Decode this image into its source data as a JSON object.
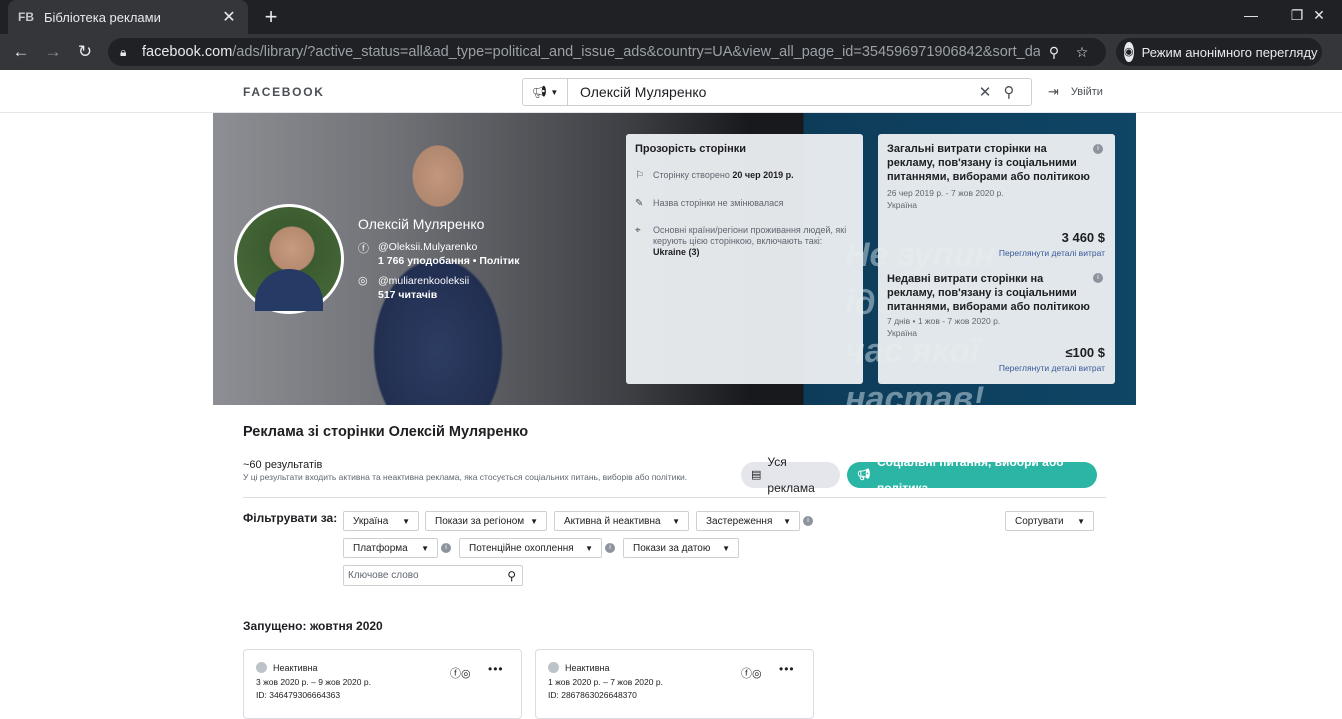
{
  "browser": {
    "tab_favicon": "FB",
    "tab_title": "Бібліотека реклами",
    "tab_close": "✕",
    "new_tab": "+",
    "url_domain": "facebook.com",
    "url_rest": "/ads/library/?active_status=all&ad_type=political_and_issue_ads&country=UA&view_all_page_id=354596971906842&sort_data[di...",
    "incognito_label": "Режим анонімного перегляду"
  },
  "fb_header": {
    "logo": "FACEBOOK",
    "search_query": "Олексій Муляренко",
    "logout_label": "Увійти"
  },
  "banner": {
    "slogan_lines": [
      "Не зупин",
      "ід",
      "час якої",
      "настав!"
    ],
    "page_name": "Олексій Муляренко",
    "facebook_handle": "@Oleksii.Mulyarenko",
    "facebook_stats": "1 766 уподобання • Політик",
    "instagram_handle": "@muliarenkooleksii",
    "instagram_stats": "517 читачів",
    "transparency": {
      "title": "Прозорість сторінки",
      "created_prefix": "Сторінку створено",
      "created_date": "20 чер 2019 р.",
      "name_unchanged": "Назва сторінки не змінювалася",
      "countries_text": "Основні країни/регіони проживання людей, які керують цією сторінкою, включають такі:",
      "countries_value": "Ukraine (3)"
    },
    "spend_total": {
      "title": "Загальні витрати сторінки на рекламу, пов'язану із соціальними питаннями, виборами або політикою",
      "period": "26 чер 2019 р. - 7 жов 2020 р.",
      "country": "Україна",
      "amount": "3 460 $",
      "link": "Переглянути деталі витрат"
    },
    "spend_recent": {
      "title": "Недавні витрати сторінки на рекламу, пов'язану із соціальними питаннями, виборами або політикою",
      "period": "7 днів • 1 жов - 7 жов 2020 р.",
      "country": "Україна",
      "amount": "≤100 $",
      "link": "Переглянути деталі витрат"
    }
  },
  "main": {
    "heading": "Реклама зі сторінки Олексій Муляренко",
    "results_count": "~60 результатів",
    "results_note": "У ці результати входить активна та неактивна реклама, яка стосується соціальних питань, виборів або політики.",
    "pill_all": "Уся реклама",
    "pill_social": "Соціальні питання, вибори або політика",
    "filter_label": "Фільтрувати за:",
    "filters": {
      "country": "Україна",
      "region": "Покази за регіоном",
      "status": "Активна й неактивна",
      "disclaimer": "Застереження",
      "sort": "Сортувати",
      "platform": "Платформа",
      "reach": "Потенційне охоплення",
      "date": "Покази за датою"
    },
    "keyword_placeholder": "Ключове слово",
    "launched_heading": "Запущено: жовтня 2020"
  },
  "ads": [
    {
      "status": "Неактивна",
      "dates": "3 жов 2020 р. – 9 жов 2020 р.",
      "id": "ID: 346479306664363"
    },
    {
      "status": "Неактивна",
      "dates": "1 жов 2020 р. – 7 жов 2020 р.",
      "id": "ID: 2867863026648370"
    }
  ],
  "colors": {
    "accent_social": "#2bb5a5",
    "link": "#385898",
    "chrome_dark": "#202124"
  },
  "icons": [
    "back-icon",
    "forward-icon",
    "reload-icon",
    "lock-icon",
    "search-icon",
    "star-icon",
    "incognito-icon",
    "megaphone-icon",
    "close-icon",
    "logout-icon",
    "facebook-icon",
    "instagram-icon",
    "flag-icon",
    "edit-icon",
    "location-icon",
    "info-icon",
    "book-icon",
    "chevron-down-icon",
    "more-icon"
  ]
}
